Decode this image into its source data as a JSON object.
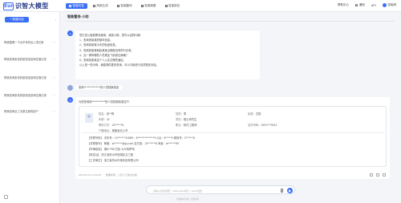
{
  "app": {
    "logo_mark": "Eun",
    "title": "识智大模型"
  },
  "top_tabs": [
    {
      "label": "智能问答",
      "active": true
    },
    {
      "label": "简报生成",
      "active": false
    },
    {
      "label": "智能翻译",
      "active": false
    },
    {
      "label": "智能摘要",
      "active": false
    },
    {
      "label": "智能报告",
      "active": false
    }
  ],
  "top_right": {
    "help": "帮助中心",
    "notices": "通知",
    "api": "API",
    "user": "张晓明"
  },
  "sidebar": {
    "new_chat": "+ 新建对话",
    "items": [
      {
        "text": "帮我整理一下近半年的出入境记录"
      },
      {
        "text": "帮我查询张伟的航班信息和住宿记录"
      },
      {
        "text": "帮我查询张伟的航班信息和住宿记录"
      },
      {
        "text": "帮我查询张伟的航班信息和住宿记录"
      },
      {
        "text": "帮我查询近三天新注册的用户"
      }
    ]
  },
  "main": {
    "header_title": "智能警务·小助",
    "intro": {
      "greeting": "您已进入智能警务使用，我是小助，您可以这样问我：",
      "lines": [
        "1、查询张某某的基本信息。",
        "2、查询张某某今天的轨迹信息。",
        "3、查询张某某和赵某某近期是否有同行记录。",
        "4、近一周有哪些人员乘坐飞机前往海南？",
        "5、查询张某某这个人入住过哪些酒店。"
      ],
      "closing": "以上是一些示例，我能提供更多查询，可以与我进行自然语言对话。"
    },
    "question": "查询****************的人员档案信息",
    "answer": {
      "head": "为您查询到*************的人员档案信息如下：",
      "fields": {
        "name_k": "姓名：",
        "name_v": "张**明",
        "sex_k": "性别：",
        "sex_v": "男",
        "nation_k": "民族：",
        "nation_v": "汉族",
        "age_k": "年龄：",
        "age_v": "32",
        "edu_k": "学历：",
        "edu_v": "硕士研究生",
        "phone_k": "联系方式：",
        "phone_v": "13*******8",
        "job_k": "职业：",
        "job_v": "软件工程师",
        "idno_k": "证件号码：",
        "idno_v": "4301****9012",
        "addr_k": "户籍地址：",
        "addr_v": "湖南省长沙市",
        "rows": [
          "【关联号码】 手机号：13********8    IMEI：8*****************4    QQ：8******0    微信号：Z*******8",
          "【关联账号】 邮箱：zh*******@qq.com    支付宝：13********8    淘宝：zh*******99",
          "【车辆信息】 湘A***88 白色 大众帕萨特",
          "【现住址】 浙江省杭州市西湖区文三路",
          "【工作单位】 浙江省杭州市某科技有限公司"
        ]
      },
      "meta": {
        "time": "2024-05-12 10:30:28",
        "source": "数据来源：公安人口信息系统"
      }
    }
  },
  "input": {
    "placeholder": "请输入您的问题，Shift+Enter换行，Enter发送"
  },
  "footer": "内容由AI生成，仅供参考"
}
